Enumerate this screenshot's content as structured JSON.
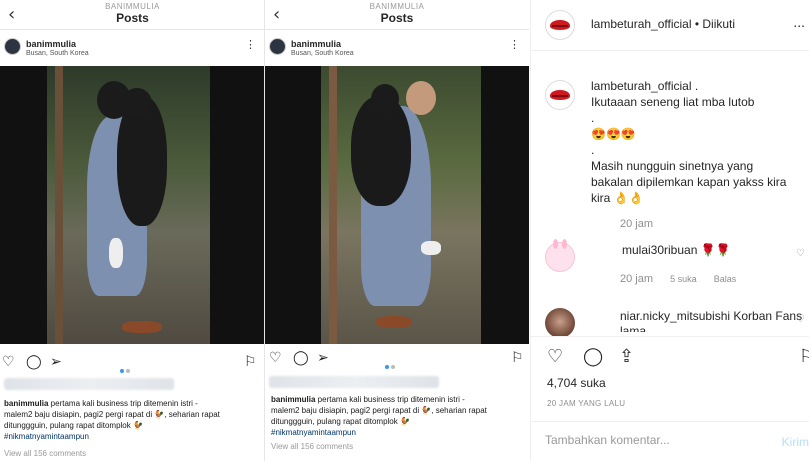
{
  "left_shots": [
    {
      "top_username": "BANIMMULIA",
      "top_title": "Posts",
      "post_username": "banimmulia",
      "location": "Busan, South Korea",
      "caption_user": "banimmulia",
      "caption_l1": " pertama kali business trip ditemenin istri -",
      "caption_l2": "malem2 baju disiapin, pagi2 pergi rapat di 🐓",
      "caption_l3": ", seharian rapat ditunggguin, pulang rapat ditomplok 🐓",
      "hashtag": "#nikmatnyamintaampun",
      "view_all": "View all 156 comments"
    },
    {
      "top_username": "BANIMMULIA",
      "top_title": "Posts",
      "caption_user": "banimmulia",
      "caption_l1": " pertama kali business trip ditemenin istri -",
      "caption_l2": "malem2 baju disiapin, pagi2 pergi rapat di 🐓",
      "caption_l3": ", seharian rapat ditunggguin, pulang rapat ditomplok 🐓",
      "view_all": "View all 156 comments"
    }
  ],
  "panel": {
    "header_name": "lambeturah_official • Diikuti",
    "header_more": "...",
    "comment1": {
      "author": "lambeturah_official",
      "line1": "lambeturah_official .",
      "line2": "Ikutaaan seneng liat mba lutob",
      "line3": ".",
      "line4": "😍😍😍",
      "line5": ".",
      "line6": "Masih nungguin sinetnya yang",
      "line7": "bakalan dipilemkan kapan yakss kira",
      "line8": "kira 👌👌",
      "time": "20 jam"
    },
    "comment2": {
      "text": "mulai30ribuan 🌹🌹",
      "time": "20 jam",
      "likes": "5 suka",
      "reply": "Balas"
    },
    "comment3": {
      "text": "niar.nicky_mitsubishi Korban Fans lama"
    },
    "likes": "4,704 suka",
    "ago": "20 JAM YANG LALU",
    "add_comment_placeholder": "Tambahkan komentar...",
    "post_label": "Kirim"
  }
}
